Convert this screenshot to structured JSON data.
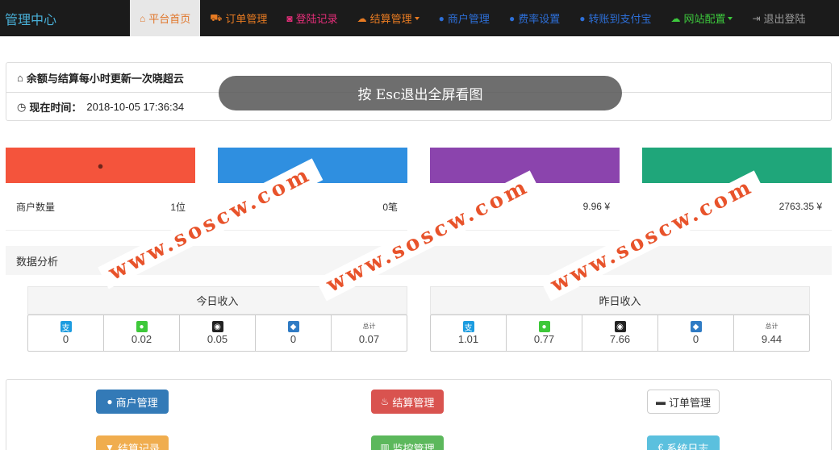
{
  "nav": {
    "brand": "管理中心",
    "items": [
      {
        "label": "平台首页",
        "icon": "home-icon",
        "glyph": "⌂",
        "color": "#e0762a",
        "active": true,
        "caret": false
      },
      {
        "label": "订单管理",
        "icon": "cart-icon",
        "glyph": "⛟",
        "color": "#e87b22",
        "active": false,
        "caret": false
      },
      {
        "label": "登陆记录",
        "icon": "camera-icon",
        "glyph": "◙",
        "color": "#e62e7a",
        "active": false,
        "caret": false
      },
      {
        "label": "结算管理",
        "icon": "cloud-icon",
        "glyph": "☁",
        "color": "#e87b22",
        "active": false,
        "caret": true
      },
      {
        "label": "商户管理",
        "icon": "user-icon",
        "glyph": "●",
        "color": "#2d6fd8",
        "active": false,
        "caret": false
      },
      {
        "label": "费率设置",
        "icon": "user-icon",
        "glyph": "●",
        "color": "#2d6fd8",
        "active": false,
        "caret": false
      },
      {
        "label": "转账到支付宝",
        "icon": "user-icon",
        "glyph": "●",
        "color": "#2d6fd8",
        "active": false,
        "caret": false
      },
      {
        "label": "网站配置",
        "icon": "cloud-icon",
        "glyph": "☁",
        "color": "#3dc93d",
        "active": false,
        "caret": true
      },
      {
        "label": "退出登陆",
        "icon": "logout-icon",
        "glyph": "⇥",
        "color": "#999999",
        "active": false,
        "caret": false
      }
    ]
  },
  "info": {
    "notice": "余额与结算每小时更新一次晓超云",
    "time_label": "现在时间：",
    "time_value": "2018-10-05 17:36:34"
  },
  "overlay": {
    "esc_text": "按 Esc退出全屏看图"
  },
  "stats": [
    {
      "color": "#f4543c",
      "icon": "user-icon",
      "glyph": "●",
      "label": "商户数量",
      "value": "1位"
    },
    {
      "color": "#2f8fe0",
      "icon": "cart-icon",
      "glyph": "",
      "label": "数",
      "value": "0笔"
    },
    {
      "color": "#8b44ad",
      "icon": "money-icon",
      "glyph": "",
      "label": "",
      "value": "9.96 ¥"
    },
    {
      "color": "#1fa67a",
      "icon": "money-icon",
      "glyph": "",
      "label": "",
      "value": "2763.35 ¥"
    }
  ],
  "analysis": {
    "title": "数据分析",
    "today": {
      "title": "今日收入",
      "cells": [
        {
          "icon": "alipay-icon",
          "glyph": "支",
          "bg": "#1c9ce0",
          "value": "0"
        },
        {
          "icon": "wechat-icon",
          "glyph": "●",
          "bg": "#3ec83a",
          "value": "0.02"
        },
        {
          "icon": "qq-icon",
          "glyph": "◉",
          "bg": "#222222",
          "value": "0.05"
        },
        {
          "icon": "shield-icon",
          "glyph": "◆",
          "bg": "#2f7bc4",
          "value": "0"
        },
        {
          "icon": "total-icon",
          "glyph": "总计",
          "bg": "",
          "value": "0.07"
        }
      ]
    },
    "yesterday": {
      "title": "昨日收入",
      "cells": [
        {
          "icon": "alipay-icon",
          "glyph": "支",
          "bg": "#1c9ce0",
          "value": "1.01"
        },
        {
          "icon": "wechat-icon",
          "glyph": "●",
          "bg": "#3ec83a",
          "value": "0.77"
        },
        {
          "icon": "qq-icon",
          "glyph": "◉",
          "bg": "#222222",
          "value": "7.66"
        },
        {
          "icon": "shield-icon",
          "glyph": "◆",
          "bg": "#2f7bc4",
          "value": "0"
        },
        {
          "icon": "total-icon",
          "glyph": "总计",
          "bg": "",
          "value": "9.44"
        }
      ]
    }
  },
  "buttons": [
    {
      "label": "商户管理",
      "icon": "user-icon",
      "glyph": "●",
      "bg": "#337ab7",
      "fg": "#ffffff"
    },
    {
      "label": "结算管理",
      "icon": "fire-icon",
      "glyph": "♨",
      "bg": "#d9534f",
      "fg": "#ffffff"
    },
    {
      "label": "订单管理",
      "icon": "minus-icon",
      "glyph": "▬",
      "bg": "#ffffff",
      "fg": "#333333"
    },
    {
      "label": "结算记录",
      "icon": "filter-icon",
      "glyph": "▼",
      "bg": "#f0ad4e",
      "fg": "#ffffff"
    },
    {
      "label": "监控管理",
      "icon": "grid-icon",
      "glyph": "▥",
      "bg": "#5cb85c",
      "fg": "#ffffff"
    },
    {
      "label": "系统日志",
      "icon": "euro-icon",
      "glyph": "€",
      "bg": "#5bc0de",
      "fg": "#ffffff"
    }
  ],
  "watermark": {
    "text": "www.soscw.com"
  }
}
